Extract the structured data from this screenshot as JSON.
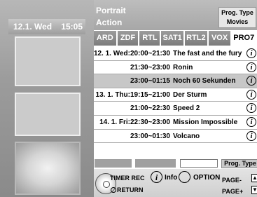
{
  "header": {
    "date": "12.1. Wed",
    "time": "15:05",
    "category_1": "Portrait",
    "category_2": "Action",
    "prog_type_label": "Prog. Type",
    "prog_type_value": "Movies"
  },
  "tabs": [
    "ARD",
    "ZDF",
    "RTL",
    "SAT1",
    "RTL2",
    "VOX",
    "PRO7"
  ],
  "active_tab": "PRO7",
  "programs": [
    {
      "date": "12. 1. Wed:",
      "time": "20:00~21:30",
      "title": "The fast and the fury"
    },
    {
      "date": "",
      "time": "21:30~23:00",
      "title": "Ronin"
    },
    {
      "date": "",
      "time": "23:00~01:15",
      "title": "Noch 60 Sekunden"
    },
    {
      "date": "13. 1. Thu:",
      "time": "19:15~21:00",
      "title": "Der Sturm"
    },
    {
      "date": "",
      "time": "21:00~22:30",
      "title": "Speed 2"
    },
    {
      "date": "14. 1. Fri:",
      "time": "22:30~23:00",
      "title": "Mission Impossible"
    },
    {
      "date": "",
      "time": "23:00~01:30",
      "title": "Volcano"
    }
  ],
  "selected_row": 2,
  "info_glyph": "i",
  "color_bar": {
    "prog_type_label": "Prog. Type"
  },
  "footer": {
    "timer_rec": "TIMER REC",
    "return": "RETURN",
    "info": "Info",
    "option": "OPTION",
    "page_minus": "PAGE-",
    "page_plus": "PAGE+"
  },
  "colors": {
    "active_tab": "#ffffff",
    "tab": "#8c8c8c",
    "selected_row": "#c7c7c7"
  }
}
